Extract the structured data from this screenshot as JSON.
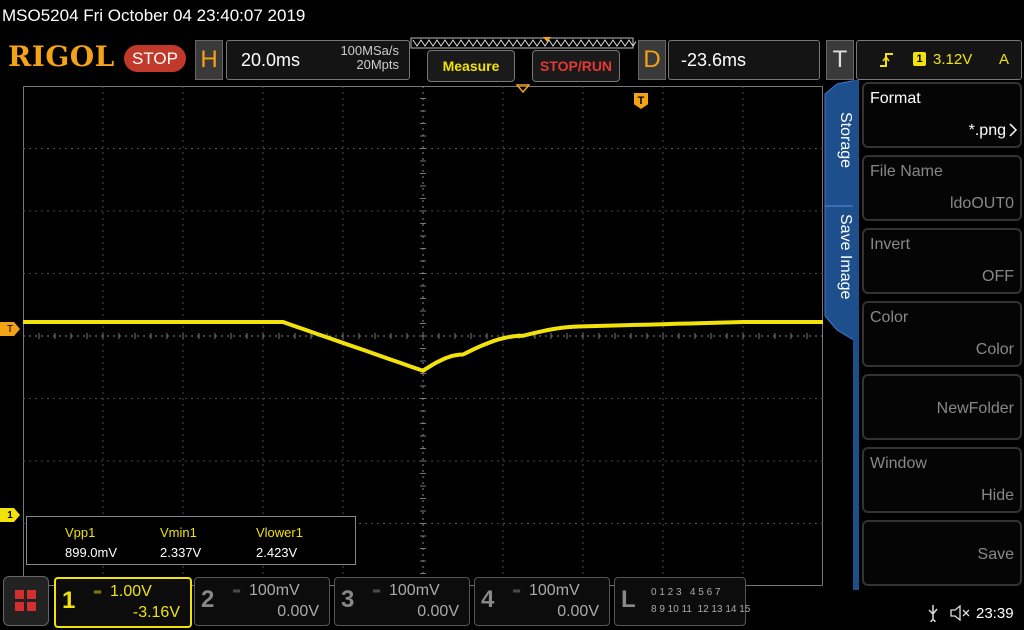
{
  "header": {
    "title": "MSO5204  Fri October 04 23:40:07 2019",
    "logo": "RIGOL",
    "run_state": "STOP",
    "horizontal": {
      "label": "H",
      "scale": "20.0ms",
      "sample_rate": "100MSa/s",
      "memory_depth": "20Mpts"
    },
    "measure_label": "Measure",
    "stoprun_label": "STOP/RUN",
    "delay": {
      "label": "D",
      "value": "-23.6ms"
    },
    "trigger": {
      "label": "T",
      "channel": "1",
      "level": "3.12V",
      "mode": "A"
    }
  },
  "markers": {
    "trigger_level_marker": "T",
    "channel1_marker": "1",
    "trigger_pos_marker": "T"
  },
  "side_menu": {
    "tab_storage": "Storage",
    "tab_save_image": "Save Image",
    "items": [
      {
        "label": "Format",
        "value": "*.png"
      },
      {
        "label": "File Name",
        "value": "ldoOUT0"
      },
      {
        "label": "Invert",
        "value": "OFF"
      },
      {
        "label": "Color",
        "value": "Color"
      },
      {
        "label": "",
        "value": "NewFolder"
      },
      {
        "label": "Window",
        "value": "Hide"
      },
      {
        "label": "",
        "value": "Save"
      }
    ]
  },
  "measurements": [
    {
      "name": "Vpp1",
      "value": "899.0mV"
    },
    {
      "name": "Vmin1",
      "value": "2.337V"
    },
    {
      "name": "Vlower1",
      "value": "2.423V"
    }
  ],
  "channels": [
    {
      "num": "1",
      "scale": "1.00V",
      "offset": "-3.16V"
    },
    {
      "num": "2",
      "scale": "100mV",
      "offset": "0.00V"
    },
    {
      "num": "3",
      "scale": "100mV",
      "offset": "0.00V"
    },
    {
      "num": "4",
      "scale": "100mV",
      "offset": "0.00V"
    }
  ],
  "logic": {
    "label": "L",
    "row1": "0 1 2 3   4 5 6 7",
    "row2": "8 9 10 11  12 13 14 15"
  },
  "status": {
    "time": "23:39"
  },
  "colors": {
    "ch1": "#f1e20a",
    "accent": "#f5a316",
    "menu_blue": "#1d4f8c",
    "stop_red": "#c0392b"
  },
  "chart_data": {
    "type": "line",
    "series": [
      {
        "values_time_ms": [
          -100,
          -35,
          0,
          10,
          25,
          40,
          80,
          100
        ],
        "values_v": [
          3.12,
          3.12,
          2.34,
          2.6,
          2.9,
          3.05,
          3.12,
          3.12
        ]
      }
    ],
    "xlim_div": [
      -5,
      5
    ],
    "grid": true
  }
}
